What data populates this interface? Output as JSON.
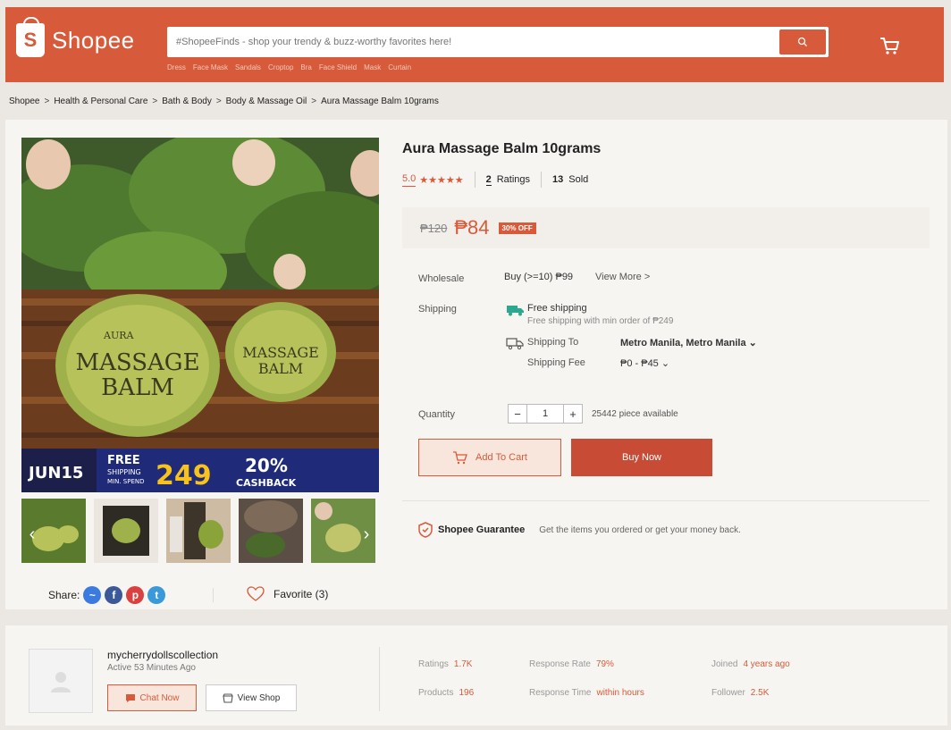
{
  "header": {
    "logo_text": "Shopee",
    "logo_letter": "S",
    "search_placeholder": "#ShopeeFinds - shop your trendy & buzz-worthy favorites here!",
    "search_tags": [
      "Dress",
      "Face Mask",
      "Sandals",
      "Croptop",
      "Bra",
      "Face Shield",
      "Mask",
      "Curtain"
    ]
  },
  "breadcrumb": [
    "Shopee",
    "Health & Personal Care",
    "Bath & Body",
    "Body & Massage Oil",
    "Aura Massage Balm 10grams"
  ],
  "breadcrumb_sep": ">",
  "product": {
    "title": "Aura Massage Balm 10grams",
    "rating": "5.0",
    "stars": "★★★★★",
    "ratings_count": "2",
    "ratings_label": "Ratings",
    "sold_count": "13",
    "sold_label": "Sold",
    "price_old": "₱120",
    "price_new": "₱84",
    "discount": "30% OFF"
  },
  "image_banner": {
    "jar_brand": "AURA",
    "jar_line1": "MASSAGE",
    "jar_line2": "BALM",
    "date": "JUN15",
    "free_label": "FREE",
    "shipping_label": "SHIPPING",
    "min_spend_label": "MIN. SPEND",
    "amount": "249",
    "cashback_pct": "20%",
    "cashback_label": "CASHBACK"
  },
  "wholesale": {
    "label": "Wholesale",
    "value": "Buy (>=10) ₱99",
    "link": "View More >"
  },
  "shipping": {
    "label": "Shipping",
    "free_title": "Free shipping",
    "free_sub": "Free shipping with min order of ₱249",
    "to_label": "Shipping To",
    "to_value": "Metro Manila, Metro Manila ⌄",
    "fee_label": "Shipping Fee",
    "fee_value": "₱0 - ₱45 ⌄"
  },
  "quantity": {
    "label": "Quantity",
    "minus": "−",
    "value": "1",
    "plus": "+",
    "available": "25442 piece available"
  },
  "actions": {
    "add_to_cart": "Add To Cart",
    "buy_now": "Buy Now"
  },
  "guarantee": {
    "title": "Shopee Guarantee",
    "text": "Get the items you ordered or get your money back."
  },
  "share": {
    "label": "Share:",
    "favorite": "Favorite (3)"
  },
  "seller": {
    "name": "mycherrydollscollection",
    "active": "Active 53 Minutes Ago",
    "chat_btn": "Chat Now",
    "shop_btn": "View Shop",
    "stats": {
      "ratings_label": "Ratings",
      "ratings_value": "1.7K",
      "products_label": "Products",
      "products_value": "196",
      "response_rate_label": "Response Rate",
      "response_rate_value": "79%",
      "response_time_label": "Response Time",
      "response_time_value": "within hours",
      "joined_label": "Joined",
      "joined_value": "4 years ago",
      "follower_label": "Follower",
      "follower_value": "2.5K"
    }
  },
  "colors": {
    "brand": "#d75a3a",
    "buy_now": "#c84b36"
  }
}
